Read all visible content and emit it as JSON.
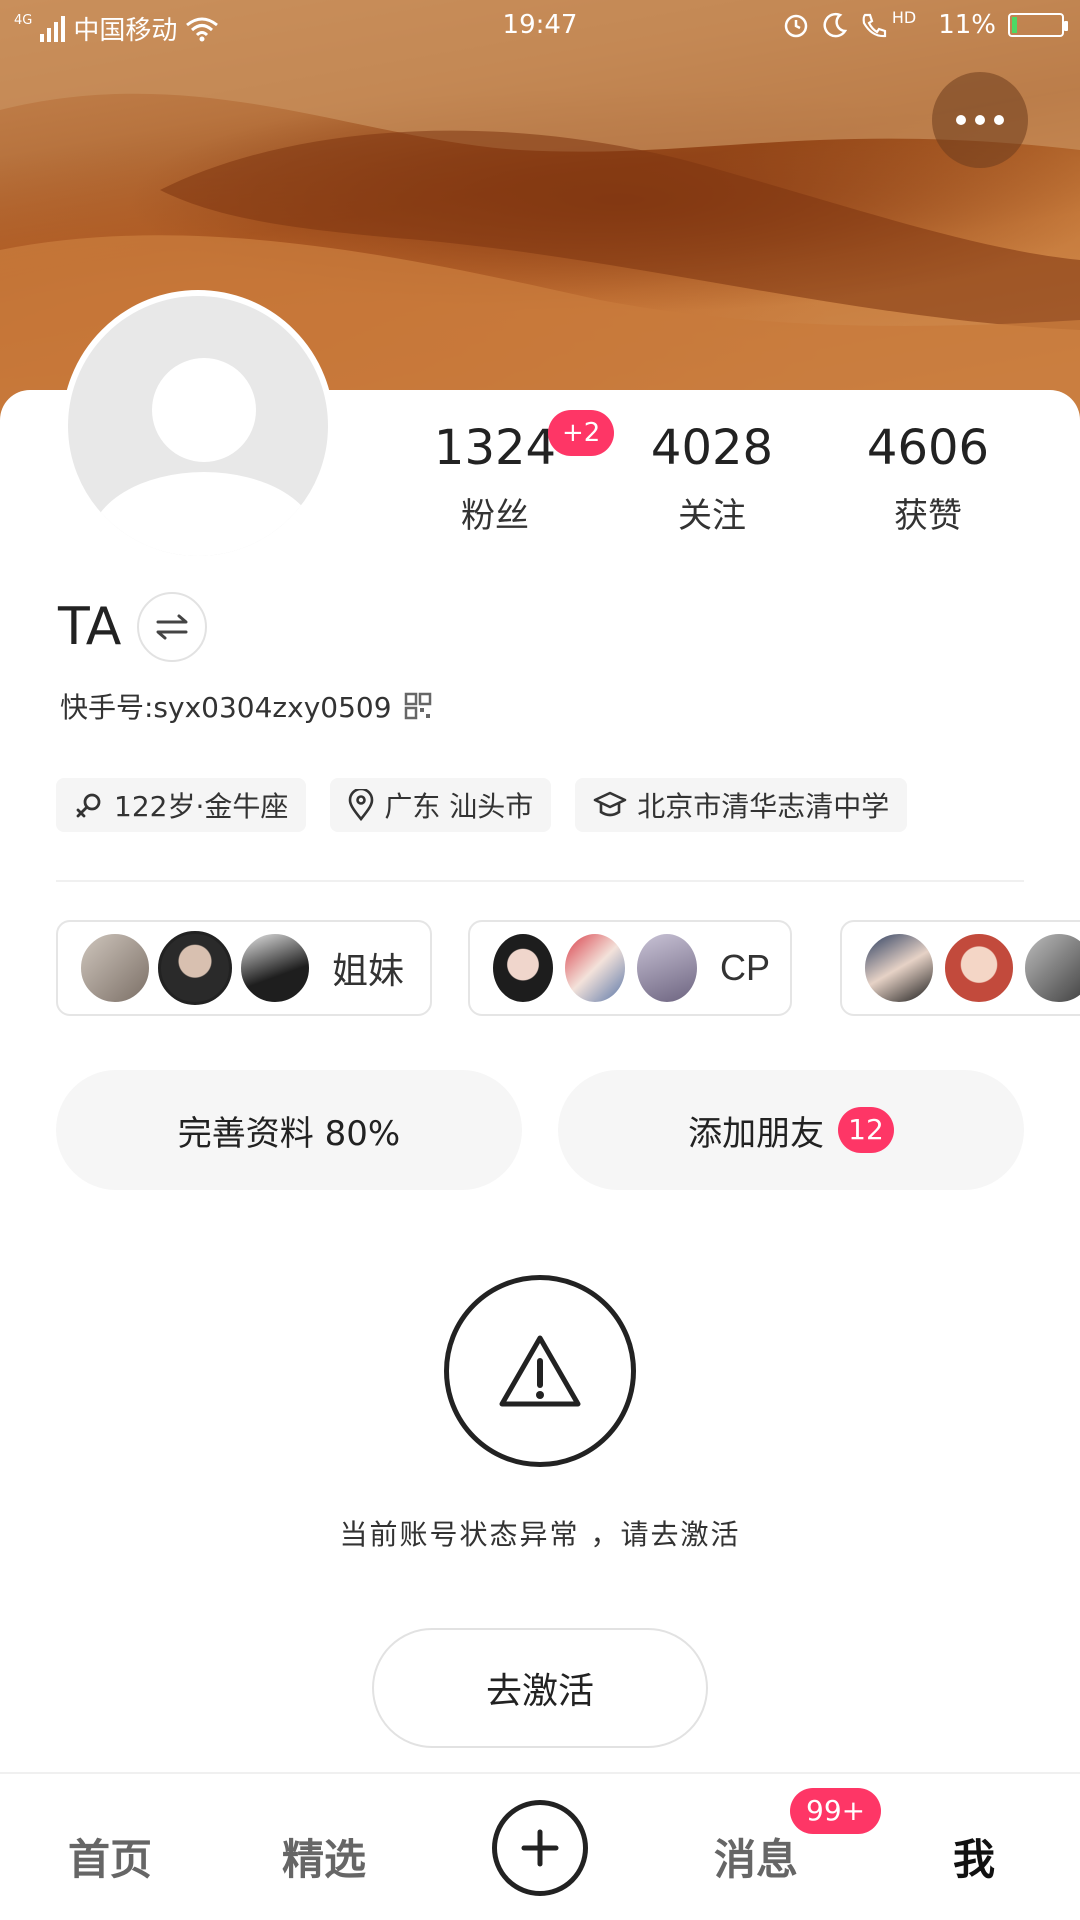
{
  "status_bar": {
    "network": "4G",
    "carrier": "中国移动",
    "time": "19:47",
    "hd": "HD",
    "battery": "11%",
    "battery_level": 0.11
  },
  "profile": {
    "name": "TA",
    "kuaishou_id": "快手号:syx0304zxy0509",
    "stats": [
      {
        "value": "1324",
        "label": "粉丝"
      },
      {
        "value": "4028",
        "label": "关注"
      },
      {
        "value": "4606",
        "label": "获赞"
      }
    ],
    "fans_badge": "+2",
    "chips": [
      {
        "icon": "female-gender-icon",
        "text": "122岁·金牛座"
      },
      {
        "icon": "location-pin-icon",
        "text": "广东 汕头市"
      },
      {
        "icon": "graduation-cap-icon",
        "text": "北京市清华志清中学"
      }
    ],
    "groups": [
      {
        "label": "姐妹"
      },
      {
        "label": "CP"
      },
      {
        "label": ""
      }
    ]
  },
  "actions": {
    "complete_profile": "完善资料 80%",
    "add_friends": "添加朋友",
    "add_friends_badge": "12"
  },
  "warning": {
    "text": "当前账号状态异常 ，请去激活",
    "button": "去激活"
  },
  "tabbar": {
    "home": "首页",
    "featured": "精选",
    "messages": "消息",
    "messages_badge": "99+",
    "me": "我"
  },
  "colors": {
    "accent": "#fe3666",
    "banner": "#b8743f"
  }
}
